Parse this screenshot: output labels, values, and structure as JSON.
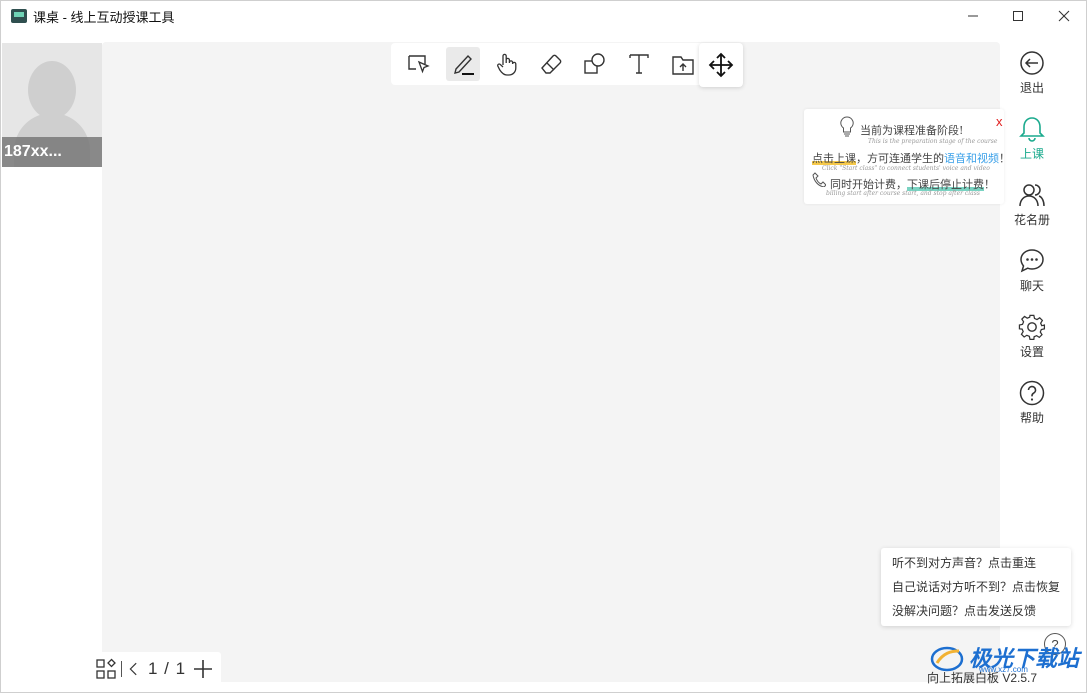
{
  "window": {
    "title": "课桌 - 线上互动授课工具",
    "min_glyph": "—",
    "max_glyph": "☐",
    "close_glyph": "✕"
  },
  "participant": {
    "name": "187xx..."
  },
  "toolbar": {
    "tools": [
      {
        "name": "select-tool",
        "icon": "select-cursor-icon",
        "active": false
      },
      {
        "name": "pen-tool",
        "icon": "pen-icon",
        "active": true
      },
      {
        "name": "hand-tool",
        "icon": "hand-icon",
        "active": false
      },
      {
        "name": "eraser-tool",
        "icon": "eraser-icon",
        "active": false
      },
      {
        "name": "shape-tool",
        "icon": "shape-icon",
        "active": false
      },
      {
        "name": "text-tool",
        "icon": "text-icon",
        "active": false
      },
      {
        "name": "upload-tool",
        "icon": "folder-upload-icon",
        "active": false
      }
    ],
    "move_icon": "move-arrows-icon"
  },
  "notice": {
    "close": "x",
    "line1": "当前为课程准备阶段!",
    "sub1": "This is the preparation stage of the course",
    "line2_a": "点击上课",
    "line2_b": "，方可连通学生的",
    "line2_c": "语音和视频",
    "line2_d": "！",
    "sub2": "Click \"Start class\" to connect students' voice and video",
    "line3_a": "同时开始计费，",
    "line3_b": "下课后停止计费",
    "line3_c": "！",
    "sub3": "billing start after course start, and stop after class"
  },
  "sidebar": {
    "items": [
      {
        "label": "退出",
        "icon": "exit-icon"
      },
      {
        "label": "上课",
        "icon": "bell-icon",
        "active": true
      },
      {
        "label": "花名册",
        "icon": "roster-icon"
      },
      {
        "label": "聊天",
        "icon": "chat-icon"
      },
      {
        "label": "设置",
        "icon": "gear-icon"
      },
      {
        "label": "帮助",
        "icon": "help-icon"
      }
    ],
    "accent": "#1aaa8d"
  },
  "help_popup": {
    "items": [
      "听不到对方声音？点击重连",
      "自己说话对方听不到？点击恢复",
      "没解决问题？点击发送反馈"
    ],
    "help_glyph": "?"
  },
  "pager": {
    "page": "1 / 1",
    "prev": "‹",
    "add": "+"
  },
  "footer": {
    "version": "向上拓展白板 V2.5.7",
    "watermark": "极光下载站",
    "watermark_sub": "www.xz7.com"
  }
}
